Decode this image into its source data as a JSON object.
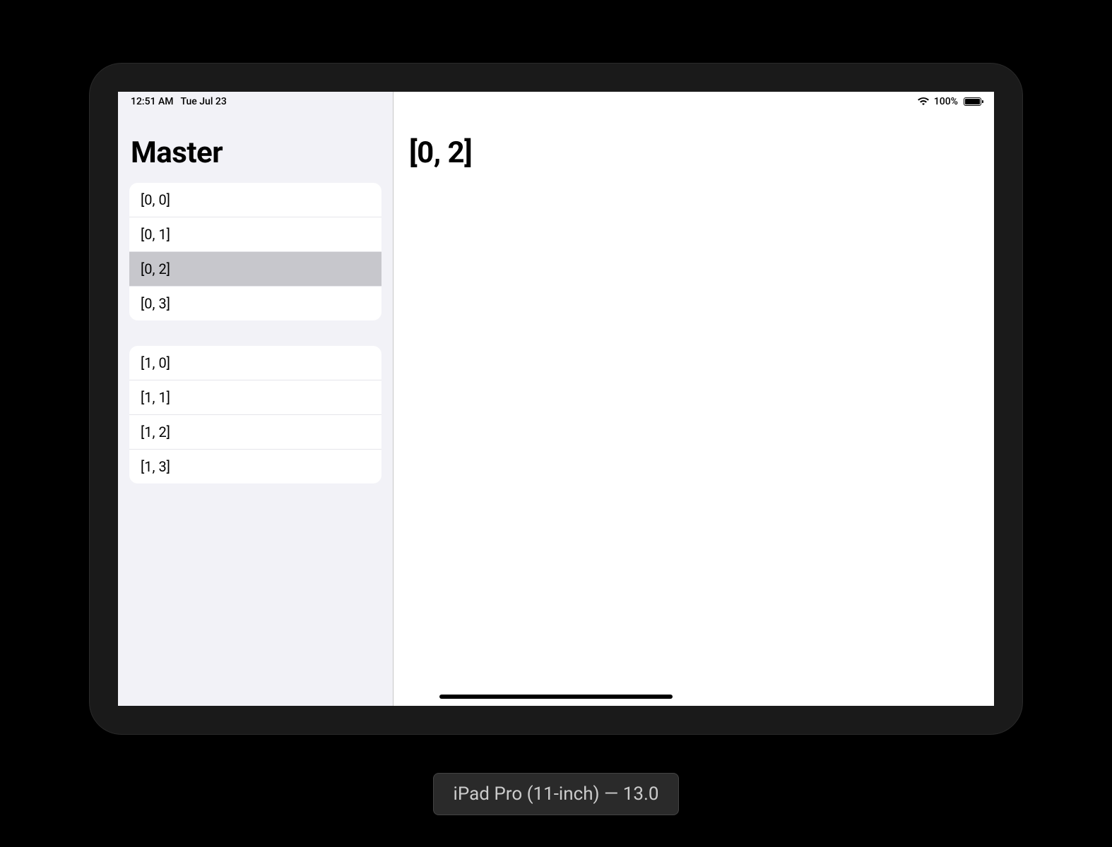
{
  "status_bar": {
    "time": "12:51 AM",
    "date": "Tue Jul 23",
    "battery_percent": "100%"
  },
  "master": {
    "title": "Master",
    "sections": [
      {
        "items": [
          {
            "label": "[0, 0]",
            "selected": false
          },
          {
            "label": "[0, 1]",
            "selected": false
          },
          {
            "label": "[0, 2]",
            "selected": true
          },
          {
            "label": "[0, 3]",
            "selected": false
          }
        ]
      },
      {
        "items": [
          {
            "label": "[1, 0]",
            "selected": false
          },
          {
            "label": "[1, 1]",
            "selected": false
          },
          {
            "label": "[1, 2]",
            "selected": false
          },
          {
            "label": "[1, 3]",
            "selected": false
          }
        ]
      }
    ]
  },
  "detail": {
    "title": "[0, 2]"
  },
  "device_label": "iPad Pro (11-inch) — 13.0"
}
